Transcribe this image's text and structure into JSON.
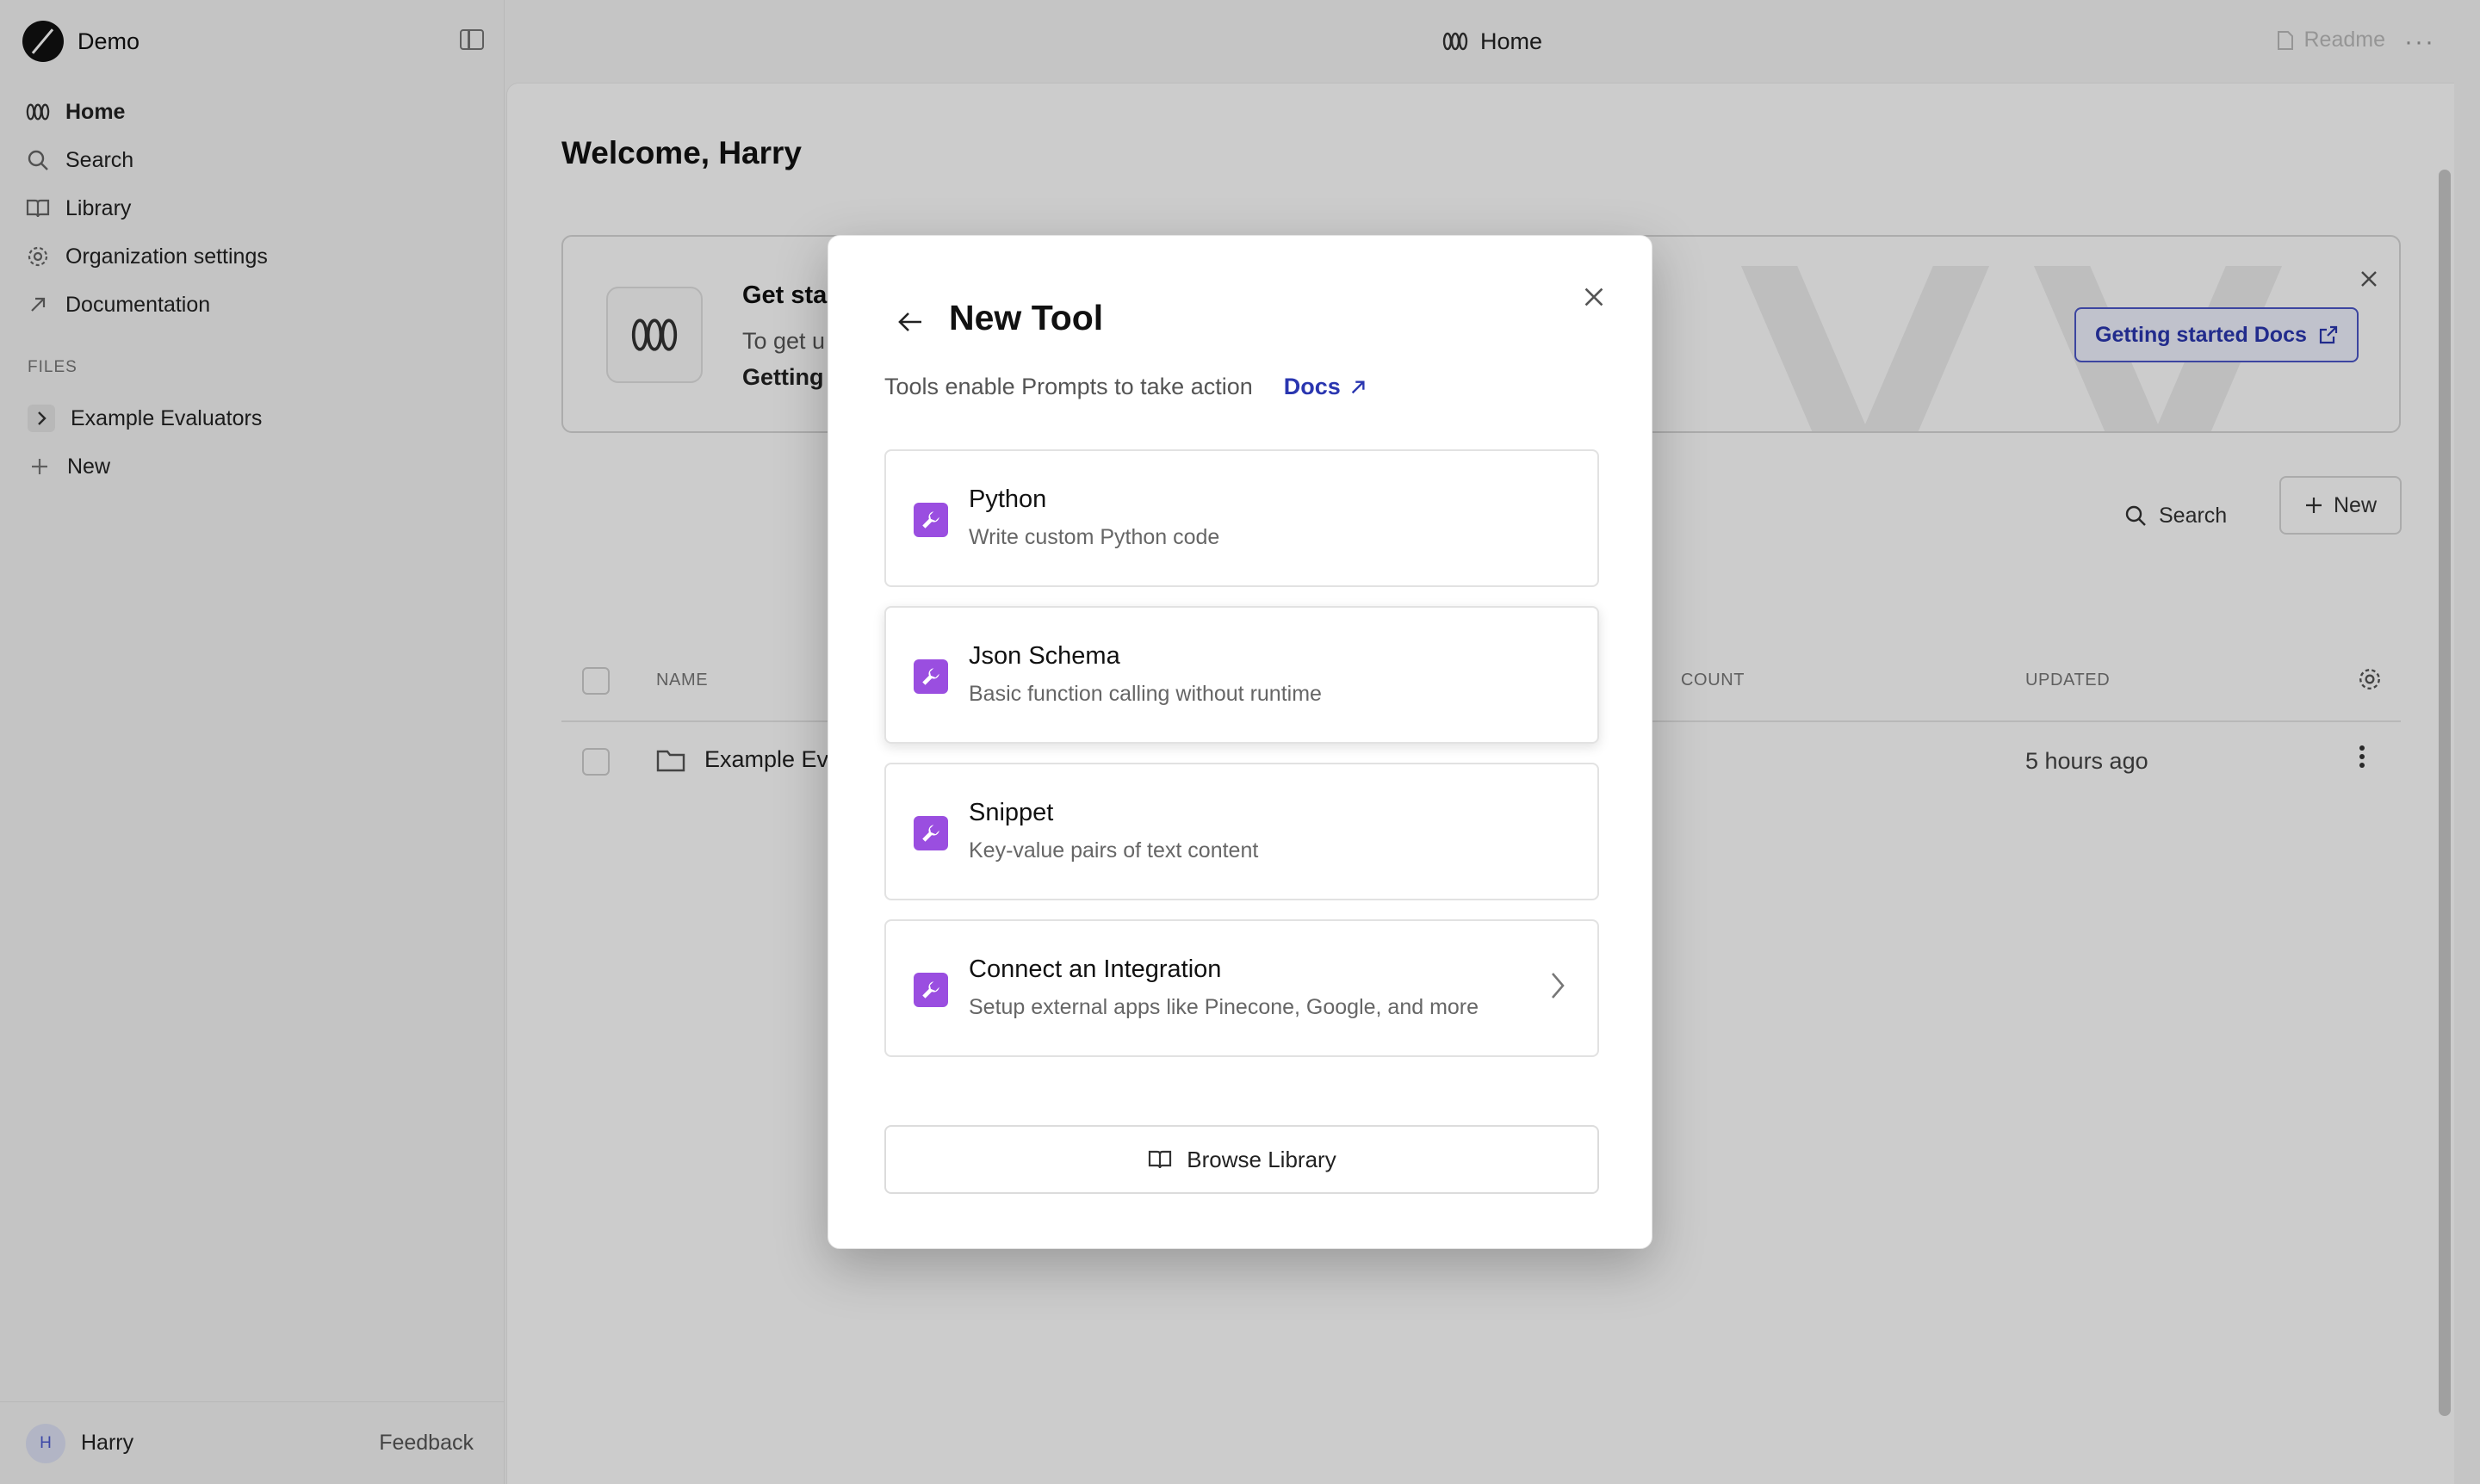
{
  "sidebar": {
    "workspace": "Demo",
    "nav": [
      {
        "label": "Home",
        "icon": "home-logo-icon"
      },
      {
        "label": "Search",
        "icon": "search-icon"
      },
      {
        "label": "Library",
        "icon": "book-icon"
      },
      {
        "label": "Organization settings",
        "icon": "gear-icon"
      },
      {
        "label": "Documentation",
        "icon": "arrow-up-right-icon"
      }
    ],
    "files_label": "FILES",
    "files": [
      {
        "label": "Example Evaluators"
      },
      {
        "label": "New"
      }
    ],
    "user": {
      "initial": "H",
      "name": "Harry"
    },
    "feedback": "Feedback"
  },
  "topbar": {
    "title": "Home",
    "readme": "Readme",
    "more": "···"
  },
  "main": {
    "welcome": "Welcome, Harry",
    "banner": {
      "title": "Get sta",
      "text_line1": "To get u",
      "text_line2": "Getting",
      "button": "Getting started Docs"
    },
    "search_label": "Search",
    "new_label": "New",
    "table": {
      "headers": {
        "name": "NAME",
        "count": "COUNT",
        "updated": "UPDATED"
      },
      "rows": [
        {
          "name": "Example Ev",
          "updated": "5 hours ago"
        }
      ]
    }
  },
  "modal": {
    "title": "New Tool",
    "subtitle": "Tools enable Prompts to take action",
    "docs": "Docs",
    "options": [
      {
        "title": "Python",
        "desc": "Write custom Python code"
      },
      {
        "title": "Json Schema",
        "desc": "Basic function calling without runtime"
      },
      {
        "title": "Snippet",
        "desc": "Key-value pairs of text content"
      },
      {
        "title": "Connect an Integration",
        "desc": "Setup external apps like Pinecone, Google, and more"
      }
    ],
    "browse": "Browse Library"
  },
  "colors": {
    "accent": "#2a36b0",
    "tool_icon": "#9a4ee0"
  }
}
